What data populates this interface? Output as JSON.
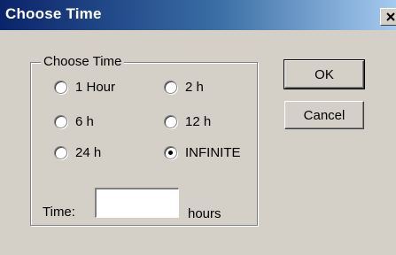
{
  "window": {
    "title": "Choose Time",
    "close_icon": "close-icon"
  },
  "group": {
    "label": "Choose Time"
  },
  "options": [
    {
      "label": "1 Hour",
      "checked": false
    },
    {
      "label": "2 h",
      "checked": false
    },
    {
      "label": "6 h",
      "checked": false
    },
    {
      "label": "12 h",
      "checked": false
    },
    {
      "label": "24 h",
      "checked": false
    },
    {
      "label": "INFINITE",
      "checked": true
    }
  ],
  "time": {
    "label": "Time:",
    "value": "",
    "unit": "hours"
  },
  "buttons": {
    "ok": "OK",
    "cancel": "Cancel"
  },
  "colors": {
    "titlebar_start": "#0a246a",
    "titlebar_end": "#a6caf0",
    "face": "#d4d0c8"
  }
}
